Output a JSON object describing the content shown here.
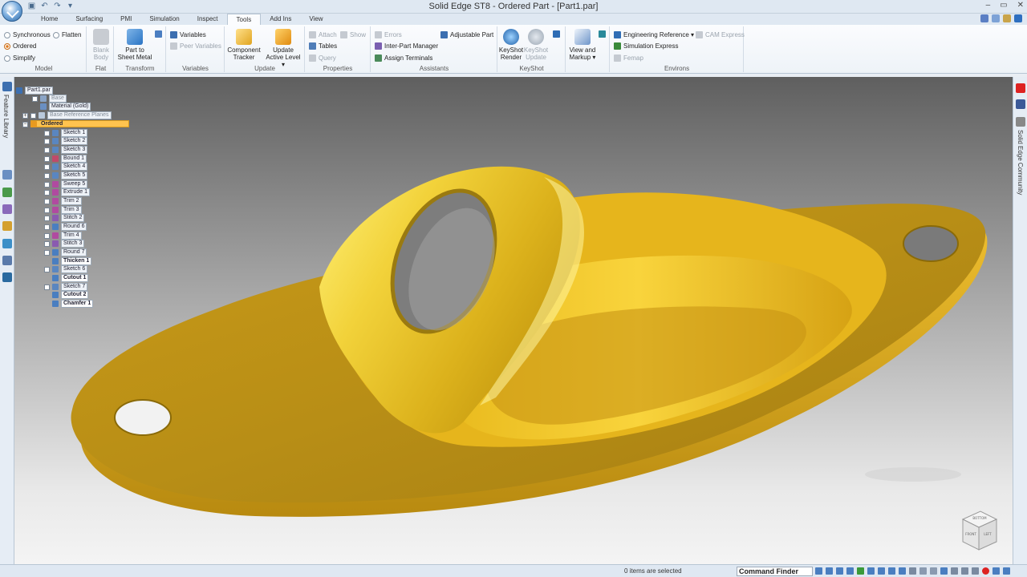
{
  "window": {
    "title": "Solid Edge ST8 - Ordered Part - [Part1.par]",
    "controls": [
      "–",
      "▭",
      "✕"
    ]
  },
  "tabs": [
    "Home",
    "Surfacing",
    "PMI",
    "Simulation",
    "Inspect",
    "Tools",
    "Add Ins",
    "View"
  ],
  "active_tab": "Tools",
  "ribbon": {
    "model": {
      "label": "Model",
      "synchronous": "Synchronous",
      "flatten": "Flatten",
      "ordered": "Ordered",
      "simplify": "Simplify"
    },
    "flat": {
      "label": "Flat",
      "blank_body": [
        "Blank",
        "Body"
      ]
    },
    "transform": {
      "label": "Transform",
      "part_to_sheet_metal": [
        "Part to",
        "Sheet Metal"
      ]
    },
    "variables": {
      "label": "Variables",
      "variables": "Variables",
      "peer_variables": "Peer Variables"
    },
    "update": {
      "label": "Update",
      "component_tracker": [
        "Component",
        "Tracker"
      ],
      "update_active_level": [
        "Update",
        "Active Level ▾"
      ]
    },
    "properties": {
      "label": "Properties",
      "attach": "Attach",
      "show": "Show",
      "tables": "Tables",
      "query": "Query"
    },
    "assistants": {
      "label": "Assistants",
      "errors": "Errors",
      "adjustable_part": "Adjustable Part",
      "inter_part_manager": "Inter-Part Manager",
      "assign_terminals": "Assign Terminals"
    },
    "keyshot": {
      "label": "KeyShot",
      "render": [
        "KeyShot",
        "Render"
      ],
      "update": [
        "KeyShot",
        "Update"
      ]
    },
    "view_markup": {
      "label": [
        "View and",
        "Markup ▾"
      ]
    },
    "environs": {
      "label": "Environs",
      "engineering_reference": "Engineering Reference ▾",
      "cam_express": "CAM Express",
      "simulation_express": "Simulation Express",
      "femap": "Femap"
    }
  },
  "left_strip": {
    "feature_library": "Feature Library"
  },
  "right_strip": {
    "community": "Solid Edge Community"
  },
  "tree": {
    "root": "Part1.par",
    "base": "Base",
    "material": "Material (Gold)",
    "base_reference_planes": "Base Reference Planes",
    "ordered": "Ordered",
    "features": [
      "Sketch 1",
      "Sketch 2",
      "Sketch 3",
      "Bound 1",
      "Sketch 4",
      "Sketch 5",
      "Sweep 5",
      "Extrude 1",
      "Trim 2",
      "Trim 3",
      "Stitch 2",
      "Round 6",
      "Trim 4",
      "Stitch 3",
      "Round 7",
      "Thicken 1",
      "Sketch 6",
      "Cutout 1",
      "Sketch 7",
      "Cutout 2",
      "Chamfer 1"
    ]
  },
  "viewcube": {
    "top": "BOTTOM",
    "front": "FRONT",
    "right": "LEFT"
  },
  "status": {
    "selection": "0 items are selected",
    "command_finder": "Command Finder"
  },
  "colors": {
    "gold_light": "#f7e36a",
    "gold_mid": "#d8b020",
    "gold_dark": "#9a7a10",
    "accent_orange": "#ffc34f"
  }
}
